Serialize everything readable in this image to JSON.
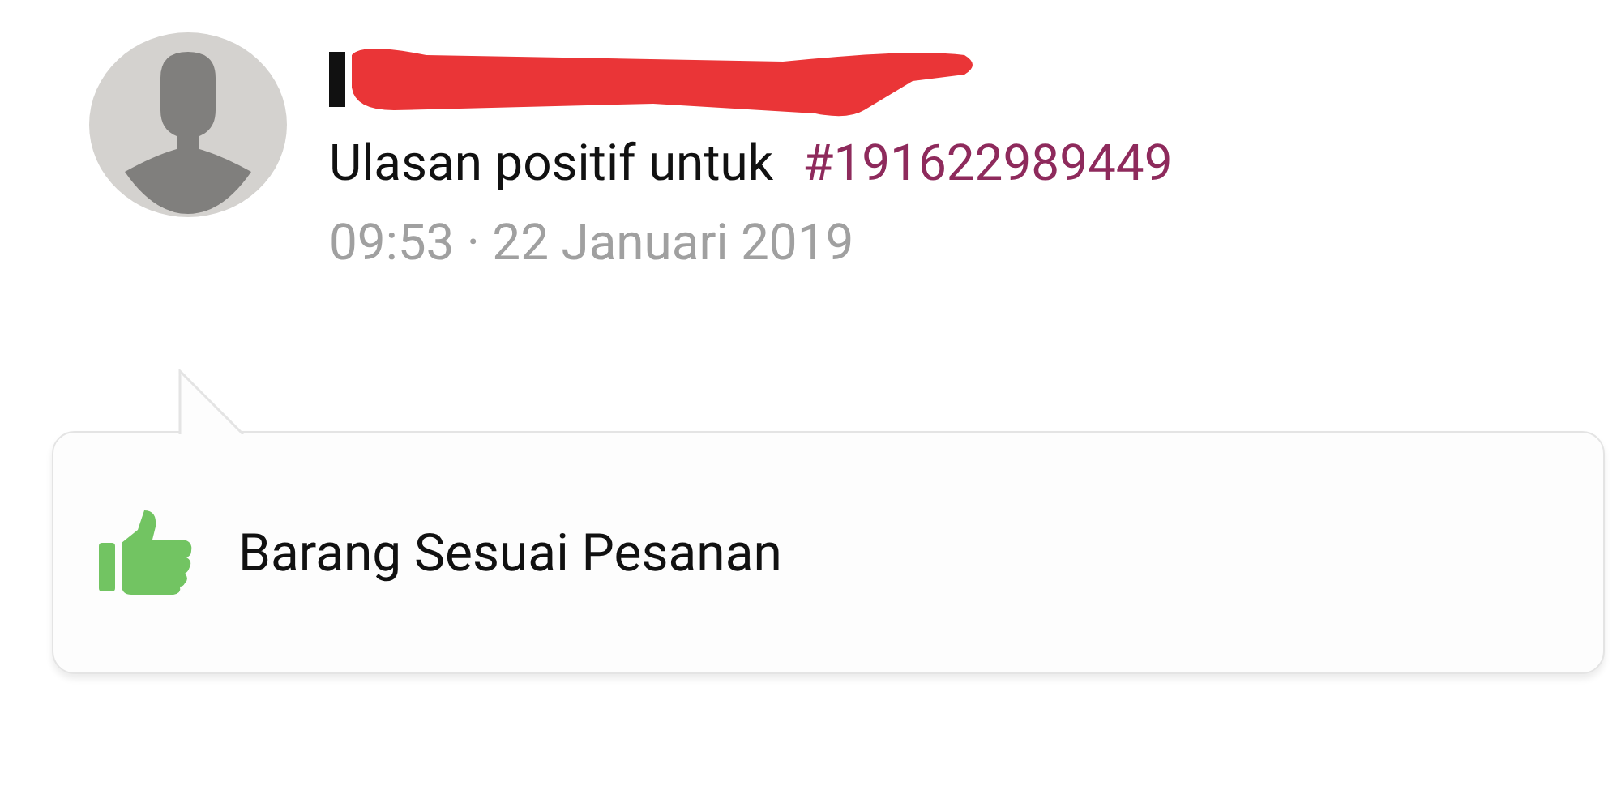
{
  "review": {
    "name_redacted": true,
    "summary": "Ulasan positif untuk",
    "order_id": "#191622989449",
    "timestamp": "09:53 · 22 Januari 2019"
  },
  "tags": [
    {
      "kind": "positive",
      "label": "Barang Sesuai Pesanan"
    }
  ]
}
